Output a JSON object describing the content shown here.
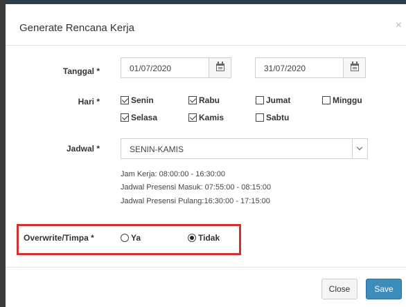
{
  "modal": {
    "title": "Generate Rencana Kerja",
    "close_icon": "×"
  },
  "form": {
    "tanggal": {
      "label": "Tanggal *",
      "from": "01/07/2020",
      "to": "31/07/2020",
      "icon": "calendar-icon"
    },
    "hari": {
      "label": "Hari *",
      "days": [
        {
          "name": "Senin",
          "checked": true
        },
        {
          "name": "Rabu",
          "checked": true
        },
        {
          "name": "Jumat",
          "checked": false
        },
        {
          "name": "Minggu",
          "checked": false
        },
        {
          "name": "Selasa",
          "checked": true
        },
        {
          "name": "Kamis",
          "checked": true
        },
        {
          "name": "Sabtu",
          "checked": false
        }
      ]
    },
    "jadwal": {
      "label": "Jadwal *",
      "selected": "SENIN-KAMIS",
      "info": [
        "Jam Kerja: 08:00:00 - 16:30:00",
        "Jadwal Presensi Masuk: 07:55:00 - 08:15:00",
        "Jadwal Presensi Pulang:16:30:00 - 17:15:00"
      ]
    },
    "overwrite": {
      "label": "Overwrite/Timpa *",
      "options": [
        {
          "name": "Ya",
          "selected": false
        },
        {
          "name": "Tidak",
          "selected": true
        }
      ]
    }
  },
  "footer": {
    "close_label": "Close",
    "save_label": "Save"
  },
  "colors": {
    "primary": "#3c8dbc",
    "highlight": "#d32f2f"
  }
}
